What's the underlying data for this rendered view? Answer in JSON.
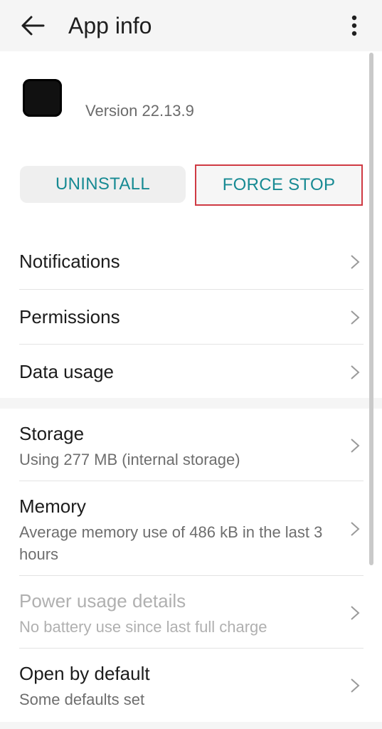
{
  "header": {
    "title": "App info",
    "back_icon": "arrow-left-icon",
    "menu_icon": "more-vert-icon"
  },
  "app": {
    "icon": "app-icon",
    "version": "Version 22.13.9"
  },
  "actions": {
    "uninstall_label": "UNINSTALL",
    "force_stop_label": "FORCE STOP"
  },
  "section1": {
    "items": [
      {
        "label": "Notifications"
      },
      {
        "label": "Permissions"
      },
      {
        "label": "Data usage"
      }
    ]
  },
  "section2": {
    "items": [
      {
        "label": "Storage",
        "sub": "Using 277 MB (internal storage)"
      },
      {
        "label": "Memory",
        "sub": "Average memory use of 486 kB in the last 3 hours"
      },
      {
        "label": "Power usage details",
        "sub": "No battery use since last full charge"
      },
      {
        "label": "Open by default",
        "sub": "Some defaults set"
      }
    ]
  },
  "colors": {
    "accent": "#178a93",
    "highlight_border": "#cf3a43"
  }
}
